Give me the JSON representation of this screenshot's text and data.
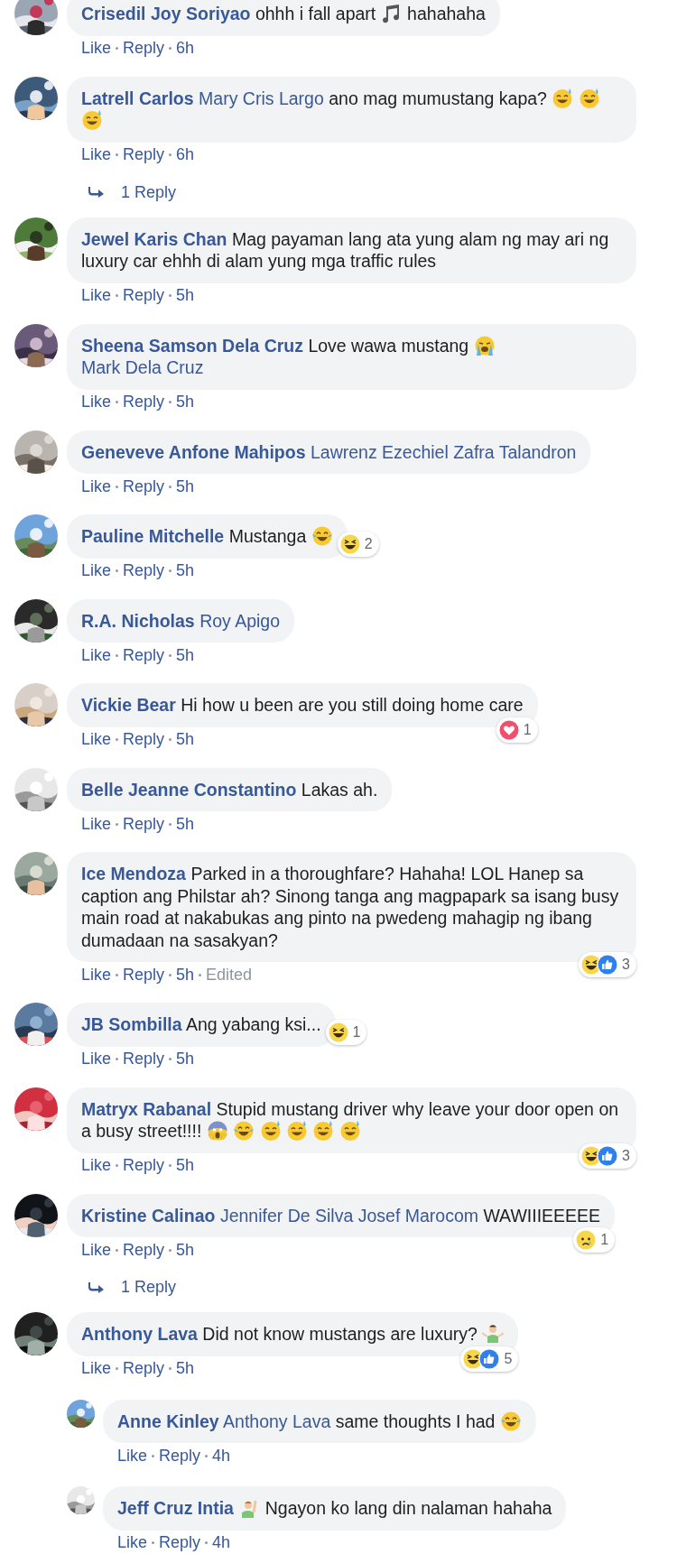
{
  "comments": [
    {
      "author": "Crisedil Joy Soriyao",
      "body": [
        {
          "kind": "text",
          "text": "ohhh i fall apart"
        },
        {
          "kind": "music"
        },
        {
          "kind": "text",
          "text": "hahahaha"
        }
      ],
      "actions": [
        "Like",
        "Reply"
      ],
      "time": "6h"
    },
    {
      "author": "Latrell Carlos",
      "body": [
        {
          "kind": "mention",
          "text": "Mary Cris Largo"
        },
        {
          "kind": "text",
          "text": "ano mag mumustang kapa?"
        },
        {
          "kind": "sweat-smile"
        },
        {
          "kind": "sweat-smile"
        },
        {
          "kind": "sweat-smile"
        }
      ],
      "actions": [
        "Like",
        "Reply"
      ],
      "time": "6h",
      "replies_link": "1 Reply"
    },
    {
      "author": "Jewel Karis Chan",
      "body": [
        {
          "kind": "text",
          "text": "Mag payaman lang ata yung alam ng may ari ng luxury car ehhh di alam yung mga traffic rules"
        }
      ],
      "actions": [
        "Like",
        "Reply"
      ],
      "time": "5h"
    },
    {
      "author": "Sheena Samson Dela Cruz",
      "body": [
        {
          "kind": "text",
          "text": "Love wawa mustang"
        },
        {
          "kind": "crying"
        },
        {
          "kind": "mention",
          "text": "Mark Dela Cruz"
        }
      ],
      "actions": [
        "Like",
        "Reply"
      ],
      "time": "5h"
    },
    {
      "author": "Geneveve Anfone Mahipos",
      "body": [
        {
          "kind": "mention",
          "text": "Lawrenz Ezechiel Zafra Talandron"
        }
      ],
      "actions": [
        "Like",
        "Reply"
      ],
      "time": "5h"
    },
    {
      "author": "Pauline Mitchelle",
      "body": [
        {
          "kind": "text",
          "text": "Mustanga"
        },
        {
          "kind": "tears-of-joy"
        }
      ],
      "actions": [
        "Like",
        "Reply"
      ],
      "time": "5h",
      "reactions": {
        "kind": "side",
        "icons": [
          {
            "kind": "haha"
          }
        ],
        "count": "2"
      }
    },
    {
      "author": "R.A. Nicholas",
      "body": [
        {
          "kind": "mention",
          "text": "Roy Apigo"
        }
      ],
      "actions": [
        "Like",
        "Reply"
      ],
      "time": "5h"
    },
    {
      "author": "Vickie Bear",
      "body": [
        {
          "kind": "text",
          "text": "Hi how u been are you still doing home care"
        }
      ],
      "actions": [
        "Like",
        "Reply"
      ],
      "time": "5h",
      "reactions": {
        "kind": "corner",
        "icons": [
          {
            "kind": "love"
          }
        ],
        "count": "1"
      }
    },
    {
      "author": "Belle Jeanne Constantino",
      "body": [
        {
          "kind": "text",
          "text": "Lakas ah."
        }
      ],
      "actions": [
        "Like",
        "Reply"
      ],
      "time": "5h"
    },
    {
      "author": "Ice Mendoza",
      "body": [
        {
          "kind": "text",
          "text": "Parked in a thoroughfare? Hahaha! LOL Hanep sa caption ang Philstar ah? Sinong tanga ang magpapark sa isang busy main road at nakabukas ang pinto na pwedeng mahagip ng ibang dumadaan na sasakyan?"
        }
      ],
      "actions": [
        "Like",
        "Reply"
      ],
      "time": "5h",
      "edited": "Edited",
      "reactions": {
        "kind": "corner",
        "icons": [
          {
            "kind": "haha"
          },
          {
            "kind": "like"
          }
        ],
        "count": "3"
      }
    },
    {
      "author": "JB Sombilla",
      "body": [
        {
          "kind": "text",
          "text": "Ang yabang ksi..."
        }
      ],
      "actions": [
        "Like",
        "Reply"
      ],
      "time": "5h",
      "reactions": {
        "kind": "side",
        "icons": [
          {
            "kind": "haha"
          }
        ],
        "count": "1"
      }
    },
    {
      "author": "Matryx Rabanal",
      "body": [
        {
          "kind": "text",
          "text": "Stupid mustang driver why leave your door open on a busy street!!!!"
        },
        {
          "kind": "scream"
        },
        {
          "kind": "tears-of-joy"
        },
        {
          "kind": "sweat-smile"
        },
        {
          "kind": "sweat-smile"
        },
        {
          "kind": "sweat-smile"
        },
        {
          "kind": "sweat-smile"
        }
      ],
      "actions": [
        "Like",
        "Reply"
      ],
      "time": "5h",
      "reactions": {
        "kind": "corner",
        "icons": [
          {
            "kind": "haha"
          },
          {
            "kind": "like"
          }
        ],
        "count": "3"
      }
    },
    {
      "author": "Kristine Calinao",
      "body": [
        {
          "kind": "mention",
          "text": "Jennifer De Silva"
        },
        {
          "kind": "mention",
          "text": "Josef Marocom"
        },
        {
          "kind": "text",
          "text": "WAWIIIEEEEE"
        }
      ],
      "actions": [
        "Like",
        "Reply"
      ],
      "time": "5h",
      "reactions": {
        "kind": "corner",
        "icons": [
          {
            "kind": "sad"
          }
        ],
        "count": "1"
      },
      "replies_link": "1 Reply"
    },
    {
      "author": "Anthony Lava",
      "body": [
        {
          "kind": "text",
          "text": "Did not know mustangs are luxury?"
        },
        {
          "kind": "shrug"
        }
      ],
      "actions": [
        "Like",
        "Reply"
      ],
      "time": "5h",
      "reactions": {
        "kind": "corner",
        "icons": [
          {
            "kind": "haha"
          },
          {
            "kind": "like"
          }
        ],
        "count": "5"
      },
      "replies": [
        {
          "author": "Anne Kinley",
          "body": [
            {
              "kind": "mention",
              "text": "Anthony Lava"
            },
            {
              "kind": "text",
              "text": "same thoughts I had"
            },
            {
              "kind": "tears-of-joy"
            }
          ],
          "actions": [
            "Like",
            "Reply"
          ],
          "time": "4h"
        },
        {
          "author": "Jeff Cruz Intia",
          "body": [
            {
              "kind": "raise-hand"
            },
            {
              "kind": "text",
              "text": "Ngayon ko lang din nalaman hahaha"
            }
          ],
          "actions": [
            "Like",
            "Reply"
          ],
          "time": "4h"
        }
      ]
    }
  ]
}
